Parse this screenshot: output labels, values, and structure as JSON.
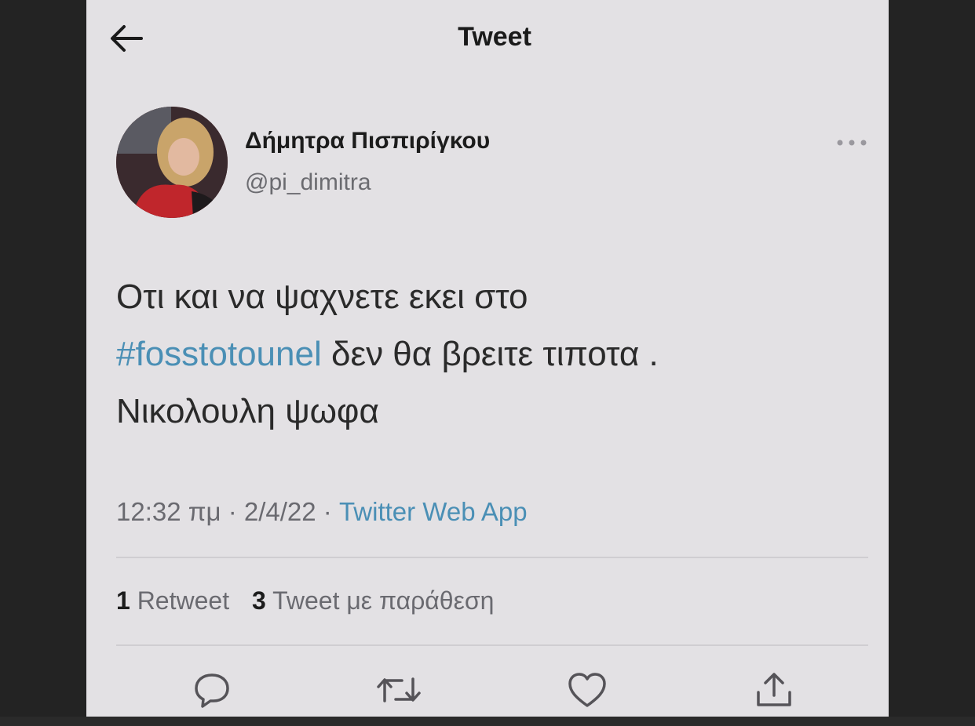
{
  "header": {
    "title": "Tweet",
    "back_icon": "arrow-left-icon"
  },
  "author": {
    "display_name": "Δήμητρα Πισπιρίγκου",
    "handle": "@pi_dimitra",
    "more_icon": "more-horizontal-icon"
  },
  "tweet": {
    "line1": "Οτι και να ψαχνετε εκει στο",
    "hashtag": "#fosstotounel",
    "line2_rest": " δεν θα βρειτε τιποτα .",
    "line3": "Νικολουλη ψωφα"
  },
  "meta": {
    "time": "12:32 πμ",
    "separator": " · ",
    "date": "2/4/22",
    "source": "Twitter Web App"
  },
  "stats": {
    "retweets_count": "1",
    "retweets_label": "Retweet",
    "quotes_count": "3",
    "quotes_label": "Tweet με παράθεση"
  },
  "actions": [
    "reply-icon",
    "retweet-icon",
    "like-icon",
    "share-icon"
  ],
  "colors": {
    "background": "#e3e1e4",
    "accent": "#4a8fb5",
    "text": "#2a2a2a",
    "muted": "#6a6a70"
  }
}
